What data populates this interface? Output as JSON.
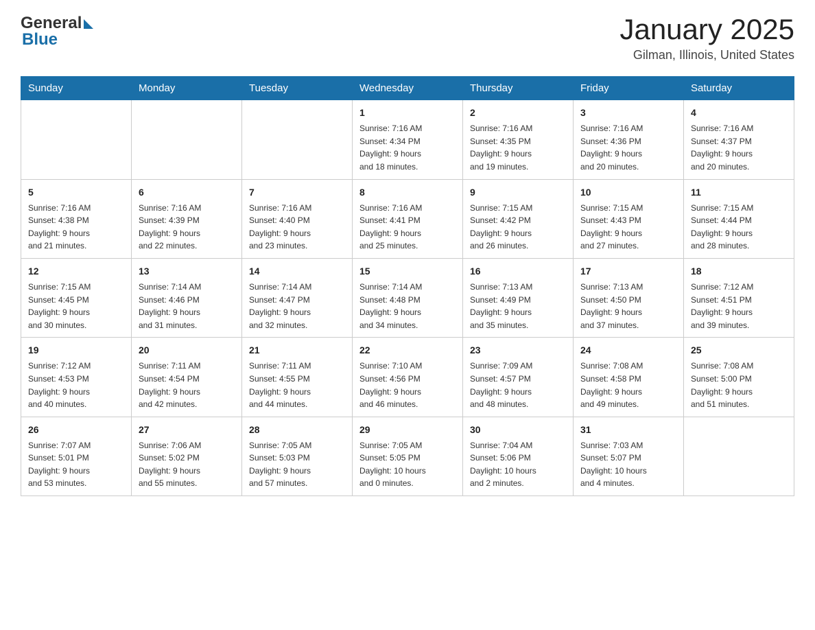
{
  "header": {
    "title": "January 2025",
    "subtitle": "Gilman, Illinois, United States",
    "logo_general": "General",
    "logo_blue": "Blue"
  },
  "days_of_week": [
    "Sunday",
    "Monday",
    "Tuesday",
    "Wednesday",
    "Thursday",
    "Friday",
    "Saturday"
  ],
  "weeks": [
    [
      {
        "day": "",
        "info": ""
      },
      {
        "day": "",
        "info": ""
      },
      {
        "day": "",
        "info": ""
      },
      {
        "day": "1",
        "info": "Sunrise: 7:16 AM\nSunset: 4:34 PM\nDaylight: 9 hours\nand 18 minutes."
      },
      {
        "day": "2",
        "info": "Sunrise: 7:16 AM\nSunset: 4:35 PM\nDaylight: 9 hours\nand 19 minutes."
      },
      {
        "day": "3",
        "info": "Sunrise: 7:16 AM\nSunset: 4:36 PM\nDaylight: 9 hours\nand 20 minutes."
      },
      {
        "day": "4",
        "info": "Sunrise: 7:16 AM\nSunset: 4:37 PM\nDaylight: 9 hours\nand 20 minutes."
      }
    ],
    [
      {
        "day": "5",
        "info": "Sunrise: 7:16 AM\nSunset: 4:38 PM\nDaylight: 9 hours\nand 21 minutes."
      },
      {
        "day": "6",
        "info": "Sunrise: 7:16 AM\nSunset: 4:39 PM\nDaylight: 9 hours\nand 22 minutes."
      },
      {
        "day": "7",
        "info": "Sunrise: 7:16 AM\nSunset: 4:40 PM\nDaylight: 9 hours\nand 23 minutes."
      },
      {
        "day": "8",
        "info": "Sunrise: 7:16 AM\nSunset: 4:41 PM\nDaylight: 9 hours\nand 25 minutes."
      },
      {
        "day": "9",
        "info": "Sunrise: 7:15 AM\nSunset: 4:42 PM\nDaylight: 9 hours\nand 26 minutes."
      },
      {
        "day": "10",
        "info": "Sunrise: 7:15 AM\nSunset: 4:43 PM\nDaylight: 9 hours\nand 27 minutes."
      },
      {
        "day": "11",
        "info": "Sunrise: 7:15 AM\nSunset: 4:44 PM\nDaylight: 9 hours\nand 28 minutes."
      }
    ],
    [
      {
        "day": "12",
        "info": "Sunrise: 7:15 AM\nSunset: 4:45 PM\nDaylight: 9 hours\nand 30 minutes."
      },
      {
        "day": "13",
        "info": "Sunrise: 7:14 AM\nSunset: 4:46 PM\nDaylight: 9 hours\nand 31 minutes."
      },
      {
        "day": "14",
        "info": "Sunrise: 7:14 AM\nSunset: 4:47 PM\nDaylight: 9 hours\nand 32 minutes."
      },
      {
        "day": "15",
        "info": "Sunrise: 7:14 AM\nSunset: 4:48 PM\nDaylight: 9 hours\nand 34 minutes."
      },
      {
        "day": "16",
        "info": "Sunrise: 7:13 AM\nSunset: 4:49 PM\nDaylight: 9 hours\nand 35 minutes."
      },
      {
        "day": "17",
        "info": "Sunrise: 7:13 AM\nSunset: 4:50 PM\nDaylight: 9 hours\nand 37 minutes."
      },
      {
        "day": "18",
        "info": "Sunrise: 7:12 AM\nSunset: 4:51 PM\nDaylight: 9 hours\nand 39 minutes."
      }
    ],
    [
      {
        "day": "19",
        "info": "Sunrise: 7:12 AM\nSunset: 4:53 PM\nDaylight: 9 hours\nand 40 minutes."
      },
      {
        "day": "20",
        "info": "Sunrise: 7:11 AM\nSunset: 4:54 PM\nDaylight: 9 hours\nand 42 minutes."
      },
      {
        "day": "21",
        "info": "Sunrise: 7:11 AM\nSunset: 4:55 PM\nDaylight: 9 hours\nand 44 minutes."
      },
      {
        "day": "22",
        "info": "Sunrise: 7:10 AM\nSunset: 4:56 PM\nDaylight: 9 hours\nand 46 minutes."
      },
      {
        "day": "23",
        "info": "Sunrise: 7:09 AM\nSunset: 4:57 PM\nDaylight: 9 hours\nand 48 minutes."
      },
      {
        "day": "24",
        "info": "Sunrise: 7:08 AM\nSunset: 4:58 PM\nDaylight: 9 hours\nand 49 minutes."
      },
      {
        "day": "25",
        "info": "Sunrise: 7:08 AM\nSunset: 5:00 PM\nDaylight: 9 hours\nand 51 minutes."
      }
    ],
    [
      {
        "day": "26",
        "info": "Sunrise: 7:07 AM\nSunset: 5:01 PM\nDaylight: 9 hours\nand 53 minutes."
      },
      {
        "day": "27",
        "info": "Sunrise: 7:06 AM\nSunset: 5:02 PM\nDaylight: 9 hours\nand 55 minutes."
      },
      {
        "day": "28",
        "info": "Sunrise: 7:05 AM\nSunset: 5:03 PM\nDaylight: 9 hours\nand 57 minutes."
      },
      {
        "day": "29",
        "info": "Sunrise: 7:05 AM\nSunset: 5:05 PM\nDaylight: 10 hours\nand 0 minutes."
      },
      {
        "day": "30",
        "info": "Sunrise: 7:04 AM\nSunset: 5:06 PM\nDaylight: 10 hours\nand 2 minutes."
      },
      {
        "day": "31",
        "info": "Sunrise: 7:03 AM\nSunset: 5:07 PM\nDaylight: 10 hours\nand 4 minutes."
      },
      {
        "day": "",
        "info": ""
      }
    ]
  ]
}
